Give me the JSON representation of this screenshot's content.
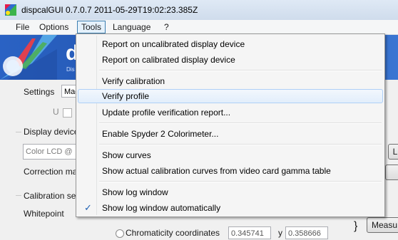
{
  "window": {
    "title": "dispcalGUI 0.7.0.7 2011-05-29T19:02:23.385Z"
  },
  "menubar": {
    "items": [
      {
        "label": "File"
      },
      {
        "label": "Options"
      },
      {
        "label": "Tools"
      },
      {
        "label": "Language"
      },
      {
        "label": "?"
      }
    ]
  },
  "background": {
    "banner_text": "d",
    "banner_sub": "Dis",
    "settings_label": "Settings",
    "settings_value": "Mac",
    "display_device_label": "Display device",
    "display_device_value": "Color LCD @",
    "correction_label": "Correction ma",
    "calibration_label": "Calibration set",
    "whitepoint_label": "Whitepoint",
    "right_btn_label": "L",
    "measure_btn_label": "Measu",
    "chromaticity_label": "Chromaticity coordinates",
    "chroma_x": "0.345741",
    "chroma_y_label": "y",
    "chroma_y": "0.358666",
    "u_label": "U"
  },
  "tools_menu": {
    "items": [
      {
        "label": "Report on uncalibrated display device",
        "checked": false
      },
      {
        "label": "Report on calibrated display device",
        "checked": false
      },
      {
        "label": "Verify calibration",
        "checked": false
      },
      {
        "label": "Verify profile",
        "checked": false,
        "highlighted": true
      },
      {
        "label": "Update profile verification report...",
        "checked": false
      },
      {
        "label": "Enable Spyder 2 Colorimeter...",
        "checked": false
      },
      {
        "label": "Show curves",
        "checked": false
      },
      {
        "label": "Show actual calibration curves from video card gamma table",
        "checked": false
      },
      {
        "label": "Show log window",
        "checked": false
      },
      {
        "label": "Show log window automatically",
        "checked": true
      }
    ],
    "check_glyph": "✓"
  }
}
